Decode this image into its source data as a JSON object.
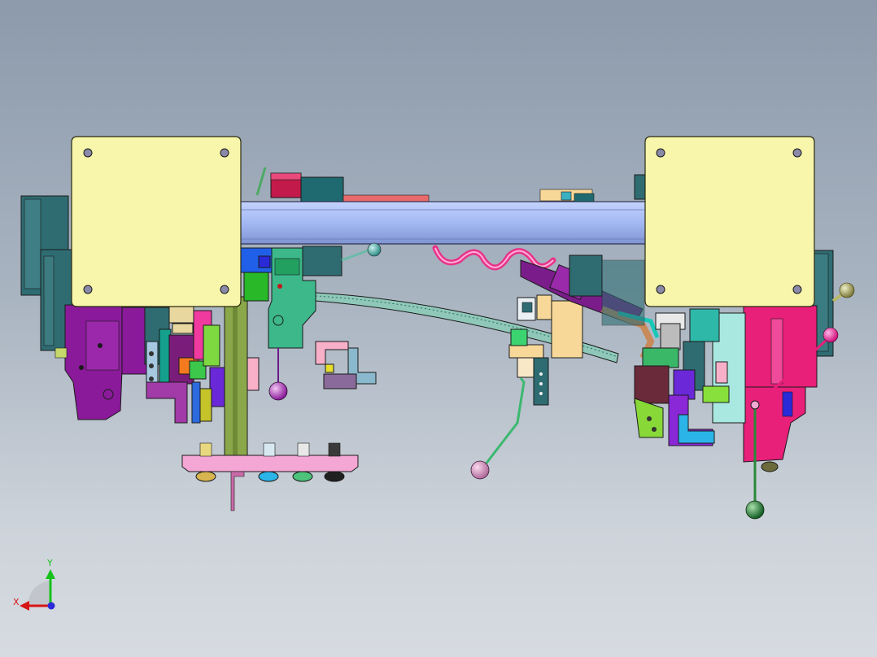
{
  "viewport": {
    "background_top": "#8c9aab",
    "background_bottom": "#d7dbe1"
  },
  "model": {
    "plate_color": "#f8f6ab",
    "beam_color": "#a9bff7",
    "hose_color": "#e8338a",
    "column_color": "#8aa84a"
  },
  "triad": {
    "x_label": "X",
    "y_label": "Y",
    "x_color": "#d81515",
    "y_color": "#15c11b",
    "z_color": "#2a2ad8"
  }
}
